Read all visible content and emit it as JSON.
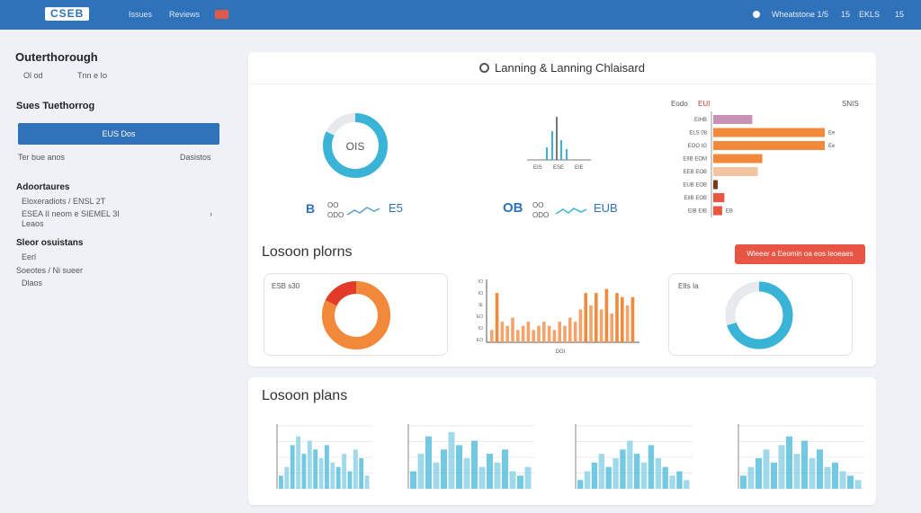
{
  "header": {
    "brand": "CSEB",
    "nav": [
      "Issues",
      "Reviews"
    ],
    "right_text": [
      "Wheatstone 1/5",
      "15",
      "EKLS",
      "15"
    ]
  },
  "sidebar": {
    "title": "Outerthorough",
    "subtitle_a": "Ol  od",
    "subtitle_b": "Tnn e Io",
    "section1": "Sues Tuethorrog",
    "button": "EUS Dos",
    "row_left": "Ter bue anos",
    "row_right": "Dasistos",
    "section2": "Adoortaures",
    "items2": [
      {
        "text": "Eloxeradiots / ENSL 2T"
      },
      {
        "text": "ESEA II neom e SIEMEL 3I",
        "extra": "›"
      },
      {
        "text": "Leaos"
      }
    ],
    "section3": "Sleor osuistans",
    "items3": [
      "Eerl",
      "Soeotes / Ni sueer",
      "Dlaos"
    ]
  },
  "dashboard": {
    "title": "Lanning & Lanning Chlaisard",
    "donut_label": "OIS",
    "donut_value": 0.82,
    "mini1": {
      "icon_text": "B",
      "label_a": "OO",
      "label_b": "ODO",
      "num": "E5"
    },
    "mini2": {
      "num": "OB",
      "label_a": "OO",
      "label_b": "ODO",
      "num2": "EUB"
    },
    "spike_labels": [
      "EIS",
      "ESE",
      "EIE"
    ],
    "hbar_header_left": "Eodo",
    "hbar_header_mid": "EUI",
    "hbar_header_right": "SNIS",
    "hbar_rows": [
      {
        "label": "EIHB",
        "value": 0.35,
        "color": "#c792b5",
        "note": ""
      },
      {
        "label": "ELS 08",
        "value": 1.0,
        "color": "#f2883a",
        "note": "Ee"
      },
      {
        "label": "EOO IG",
        "value": 1.0,
        "color": "#f2883a",
        "note": "Ee"
      },
      {
        "label": "EIIB EOM",
        "value": 0.44,
        "color": "#f2883a",
        "note": ""
      },
      {
        "label": "EEB EOB",
        "value": 0.4,
        "color": "#f2c5a0",
        "note": ""
      },
      {
        "label": "EUB EOB",
        "value": 0.04,
        "color": "#7a3a1a",
        "note": ""
      },
      {
        "label": "EIIB EOB",
        "value": 0.1,
        "color": "#ea5540",
        "note": ""
      },
      {
        "label": "EIB EIB",
        "value": 0.08,
        "color": "#ea5540",
        "note": "EB"
      }
    ],
    "section_title": "Losoon plorns",
    "action_button": "Wieeer a Eeomin oa eos Ieoeaes",
    "card_a_label": "ESB s30",
    "card_a_value": 0.85,
    "bar_chart_label": "DGI",
    "bar_chart_ticks": [
      "IO",
      "IO",
      "IE",
      "EO",
      "IO",
      "EO"
    ],
    "bar_values": [
      3,
      12,
      5,
      4,
      6,
      3,
      4,
      5,
      3,
      4,
      5,
      4,
      3,
      5,
      4,
      6,
      5,
      8,
      12,
      9,
      12,
      8,
      13,
      7,
      12,
      11,
      9,
      11
    ],
    "card_c_label": "EIIs Ia",
    "card_c_value": 0.7,
    "lower_title": "Losoon plans",
    "hist_sets": [
      [
        3,
        5,
        10,
        12,
        8,
        11,
        9,
        7,
        10,
        6,
        5,
        8,
        4,
        9,
        7,
        3
      ],
      [
        4,
        8,
        12,
        6,
        9,
        13,
        10,
        7,
        11,
        5,
        8,
        6,
        9,
        4,
        3,
        5
      ],
      [
        2,
        4,
        6,
        8,
        5,
        7,
        9,
        11,
        8,
        6,
        10,
        7,
        5,
        3,
        4,
        2
      ],
      [
        3,
        5,
        7,
        9,
        6,
        10,
        12,
        8,
        11,
        7,
        9,
        5,
        6,
        4,
        3,
        2
      ]
    ],
    "colors": {
      "accent": "#2f72b9",
      "teal": "#3ab4d6",
      "orange": "#f2883a",
      "red": "#e85544",
      "light_teal": "#8fd2e6"
    }
  }
}
